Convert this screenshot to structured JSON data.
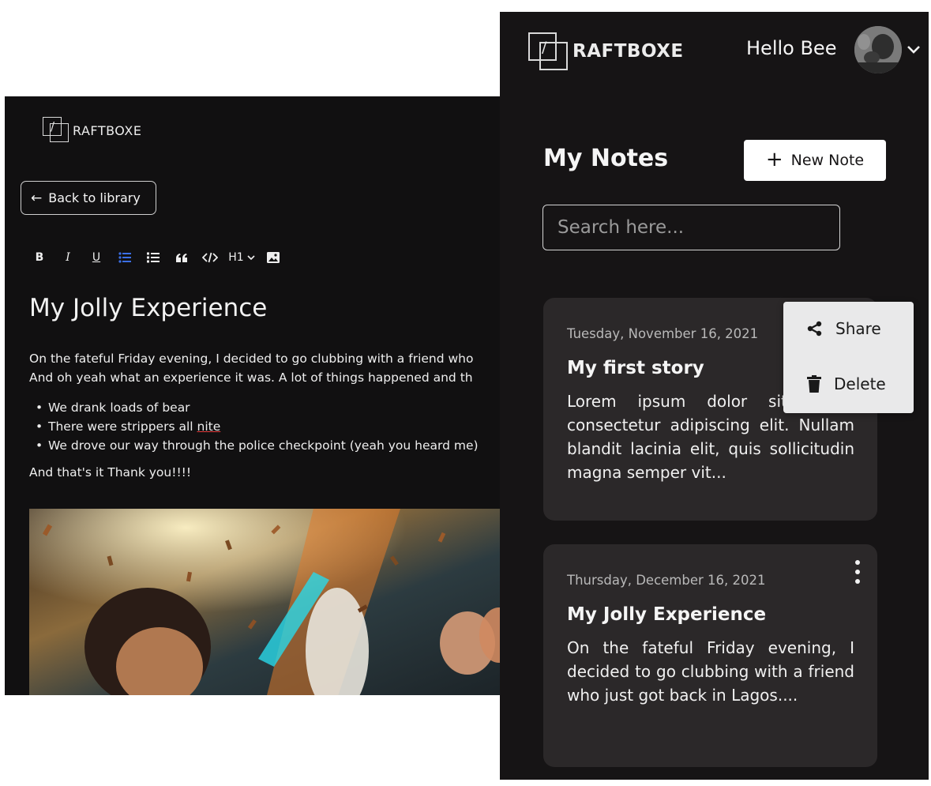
{
  "editor": {
    "logo_text": "RAFTBOXE",
    "back_label": "Back to library",
    "toolbar": {
      "bold": "B",
      "italic": "I",
      "underline": "U",
      "heading": "H1"
    },
    "doc": {
      "title": "My Jolly Experience",
      "para1_line1": "On the fateful Friday evening, I decided to go clubbing with a friend who",
      "para1_line2": "And oh yeah what an experience it was.  A lot of things happened and th",
      "bullets": [
        "We drank loads of bear",
        "There were strippers all ",
        "We drove our way through the police checkpoint (yeah you heard me)"
      ],
      "misspelled_word": "nite",
      "closing": "And that's it Thank you!!!!"
    }
  },
  "notes": {
    "logo_text": "RAFTBOXE",
    "greeting": "Hello Bee",
    "title": "My Notes",
    "new_note_label": "New Note",
    "search_placeholder": "Search here...",
    "cards": [
      {
        "date": "Tuesday, November 16, 2021",
        "title": "My first story",
        "excerpt": "Lorem ipsum dolor sit amet, consectetur adipiscing elit. Nullam blandit lacinia elit, quis sollicitudin magna semper vit..."
      },
      {
        "date": "Thursday, December 16, 2021",
        "title": "My Jolly Experience",
        "excerpt": "On the fateful Friday evening, I decided to go clubbing with a friend who just got back in Lagos...."
      }
    ],
    "context_menu": {
      "share_label": "Share",
      "delete_label": "Delete"
    }
  }
}
